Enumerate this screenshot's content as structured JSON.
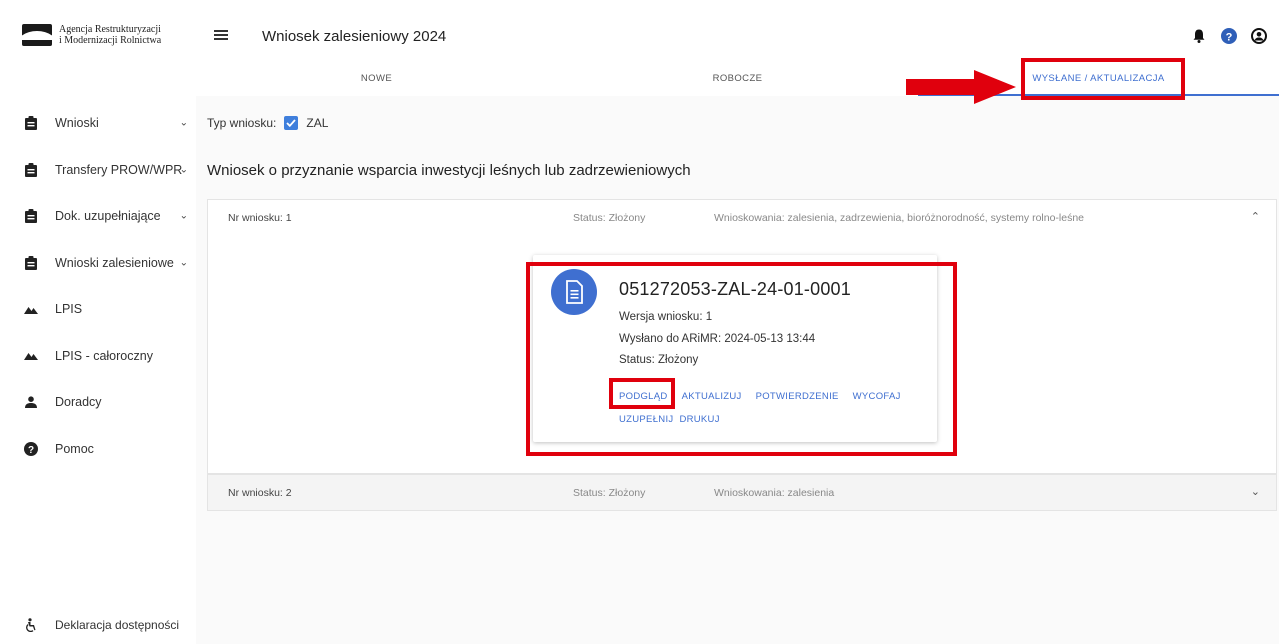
{
  "sidebar": {
    "logo_line1": "Agencja Restrukturyzacji",
    "logo_line2": "i Modernizacji Rolnictwa",
    "logo_mark_text": "ARiMR",
    "items": [
      {
        "label": "Wnioski",
        "icon": "clipboard-icon",
        "has_chevron": true
      },
      {
        "label": "Transfery PROW/WPR",
        "icon": "clipboard-icon",
        "has_chevron": true
      },
      {
        "label": "Dok. uzupełniające",
        "icon": "clipboard-icon",
        "has_chevron": true
      },
      {
        "label": "Wnioski zalesieniowe",
        "icon": "clipboard-icon",
        "has_chevron": true
      },
      {
        "label": "LPIS",
        "icon": "terrain-icon",
        "has_chevron": false
      },
      {
        "label": "LPIS - całoroczny",
        "icon": "terrain-icon",
        "has_chevron": false
      },
      {
        "label": "Doradcy",
        "icon": "person-icon",
        "has_chevron": false
      },
      {
        "label": "Pomoc",
        "icon": "help-icon",
        "has_chevron": false
      }
    ],
    "footer_label": "Deklaracja dostępności"
  },
  "header": {
    "title": "Wniosek zalesieniowy 2024",
    "icons": [
      "bell-icon",
      "help-circle-icon",
      "account-icon"
    ]
  },
  "tabs": [
    {
      "label": "NOWE",
      "active": false
    },
    {
      "label": "ROBOCZE",
      "active": false
    },
    {
      "label": "WYSŁANE / AKTUALIZACJA",
      "active": true
    }
  ],
  "filter": {
    "type_label": "Typ wniosku:",
    "type_value": "ZAL",
    "checked": true
  },
  "section_title": "Wniosek o przyznanie wsparcia inwestycji leśnych lub zadrzewieniowych",
  "applications": [
    {
      "nr": "Nr wniosku: 1",
      "status": "Status: Złożony",
      "wnioskowania": "Wnioskowania: zalesienia, zadrzewienia, bioróżnorodność, systemy rolno-leśne",
      "expanded": true
    },
    {
      "nr": "Nr wniosku: 2",
      "status": "Status: Złożony",
      "wnioskowania": "Wnioskowania: zalesienia",
      "expanded": false
    }
  ],
  "card": {
    "title": "051272053-ZAL-24-01-0001",
    "version": "Wersja wniosku: 1",
    "sent": "Wysłano do ARiMR: 2024-05-13 13:44",
    "status": "Status: Złożony",
    "actions": [
      "PODGLĄD",
      "AKTUALIZUJ",
      "POTWIERDZENIE",
      "WYCOFAJ",
      "UZUPEŁNIJ",
      "DRUKUJ"
    ]
  },
  "colors": {
    "accent": "#3f6fd0",
    "highlight": "#e0000d"
  }
}
